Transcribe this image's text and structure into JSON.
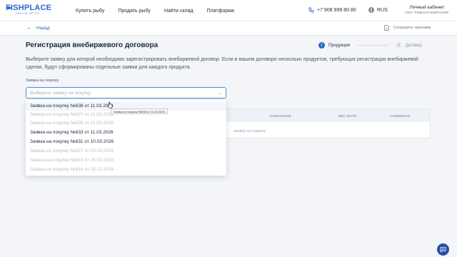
{
  "header": {
    "logo_main": "FISHPLACE",
    "logo_sub": "РЫБНОЕ МЕСТО",
    "nav": [
      "Купить рыбу",
      "Продать рыбу",
      "Найти склад",
      "Платформа"
    ],
    "phone": "+7 908 999 80 80",
    "language": "RUS",
    "account_title": "Личный кабинет",
    "account_company": "ООО \"РЫБНАЯ КОМПАНИЯ\""
  },
  "subbar": {
    "back_label": "Назад",
    "save_draft_label": "Сохранить черновик"
  },
  "page": {
    "title": "Регистрация внебиржевого договора",
    "steps": [
      {
        "number": "1",
        "label": "Продукция",
        "active": true
      },
      {
        "number": "2",
        "label": "Договор",
        "active": false
      }
    ],
    "description": "Выберите заявку для которой необходимо зарегистрировать внебиржевой договор. Если в вашем договоре несколько продуктов, требующих регистрации внебиржевой сделки, будут сформированы отдельные заявки для каждого продукта."
  },
  "form": {
    "field_label": "Заявка на покупку",
    "select_placeholder": "Выберите заявку на покупку",
    "options": [
      {
        "label": "Заявка на покупку №638 от 11.03.2026",
        "enabled": true
      },
      {
        "label": "Заявка на покупку №637 от 11.03.2026",
        "enabled": false
      },
      {
        "label": "Заявка на покупку №636 от 11.03.2026",
        "enabled": false
      },
      {
        "label": "Заявка на покупку №633 от 11.03.2026",
        "enabled": true
      },
      {
        "label": "Заявка на покупку №631 от 10.03.2026",
        "enabled": true
      },
      {
        "label": "Заявка на покупку №627 от 03.03.2026",
        "enabled": false
      },
      {
        "label": "Заявка на покупку №619 от 25.02.2026",
        "enabled": false
      },
      {
        "label": "Заявка на покупку №618 от 25.02.2026",
        "enabled": false
      }
    ],
    "tooltip": "Заявка на покупку №638 от 11.03.2026"
  },
  "table": {
    "columns": [
      "ПОКУПАТЕЛЬ",
      "ВЕС НЕТТО",
      "СТОИМОСТЬ"
    ],
    "empty_text": "заявку на покупку"
  },
  "colors": {
    "accent": "#2a66c7",
    "disabled_text": "#b7bec8",
    "chat_button": "#2a4fa8"
  }
}
